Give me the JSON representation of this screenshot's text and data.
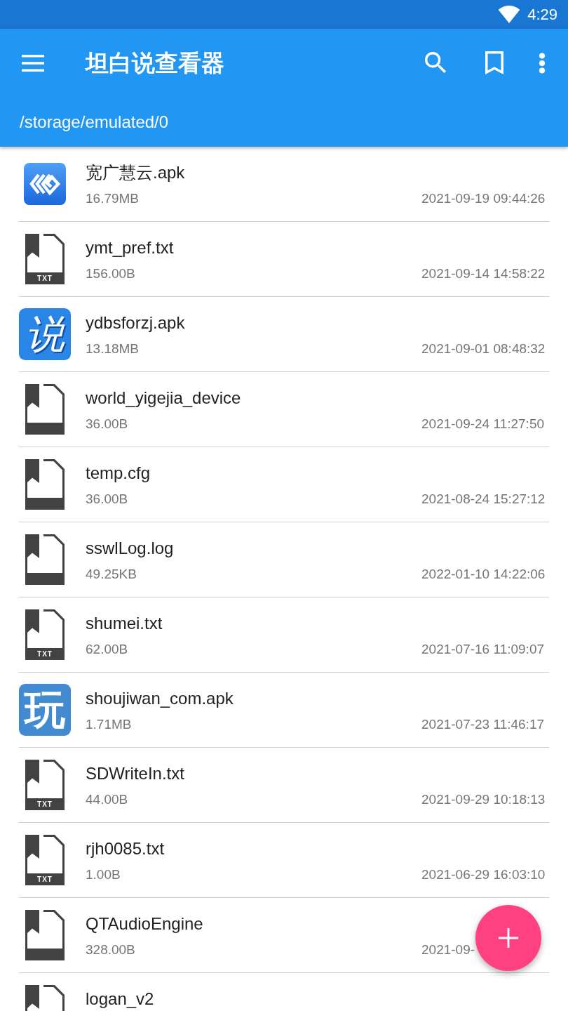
{
  "status_bar": {
    "time": "4:29"
  },
  "app_bar": {
    "title": "坦白说查看器",
    "path": "/storage/emulated/0"
  },
  "files": [
    {
      "name": "宽广慧云.apk",
      "size": "16.79MB",
      "date": "2021-09-19 09:44:26",
      "icon": {
        "kind": "logo"
      }
    },
    {
      "name": "ymt_pref.txt",
      "size": "156.00B",
      "date": "2021-09-14 14:58:22",
      "icon": {
        "kind": "txt",
        "label": "TXT"
      }
    },
    {
      "name": "ydbsforzj.apk",
      "size": "13.18MB",
      "date": "2021-09-01 08:48:32",
      "icon": {
        "kind": "script",
        "glyph": "说"
      }
    },
    {
      "name": "world_yigejia_device",
      "size": "36.00B",
      "date": "2021-09-24 11:27:50",
      "icon": {
        "kind": "file"
      }
    },
    {
      "name": "temp.cfg",
      "size": "36.00B",
      "date": "2021-08-24 15:27:12",
      "icon": {
        "kind": "file"
      }
    },
    {
      "name": "sswlLog.log",
      "size": "49.25KB",
      "date": "2022-01-10 14:22:06",
      "icon": {
        "kind": "file"
      }
    },
    {
      "name": "shumei.txt",
      "size": "62.00B",
      "date": "2021-07-16 11:09:07",
      "icon": {
        "kind": "txt",
        "label": "TXT"
      }
    },
    {
      "name": "shoujiwan_com.apk",
      "size": "1.71MB",
      "date": "2021-07-23 11:46:17",
      "icon": {
        "kind": "glyph",
        "glyph": "玩"
      }
    },
    {
      "name": "SDWriteIn.txt",
      "size": "44.00B",
      "date": "2021-09-29 10:18:13",
      "icon": {
        "kind": "txt",
        "label": "TXT"
      }
    },
    {
      "name": "rjh0085.txt",
      "size": "1.00B",
      "date": "2021-06-29 16:03:10",
      "icon": {
        "kind": "txt",
        "label": "TXT"
      }
    },
    {
      "name": "QTAudioEngine",
      "size": "328.00B",
      "date": "2021-09-",
      "icon": {
        "kind": "file"
      }
    },
    {
      "name": "logan_v2",
      "icon": {
        "kind": "file"
      }
    }
  ]
}
